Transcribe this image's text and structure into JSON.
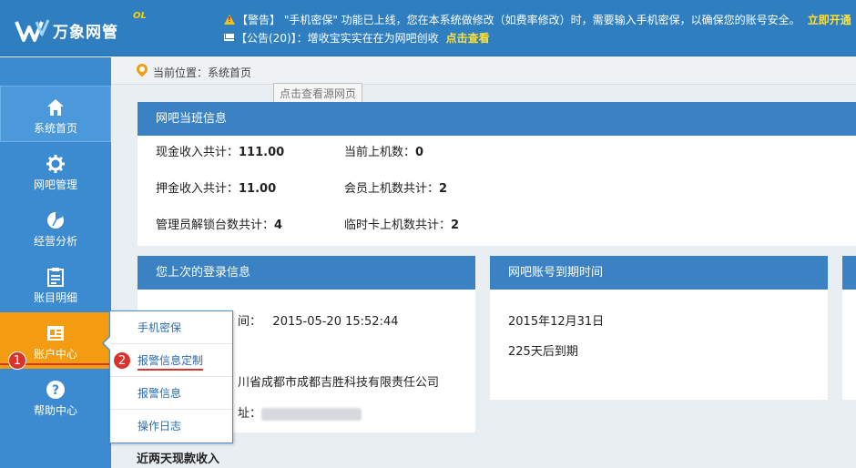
{
  "header": {
    "logo_text": "万象网管",
    "logo_sup": "OL",
    "warning_text": "【警告】 \"手机密保\" 功能已上线，您在本系统做修改（如费率修改）时，需要输入手机密保，以确保您的账号安全。",
    "warning_link": "立即开通",
    "announce_text": "【公告(20)】：增收宝实实在在为网吧创收",
    "announce_link": "点击查看"
  },
  "sidebar": {
    "items": [
      {
        "label": "系统首页",
        "icon": "home-icon"
      },
      {
        "label": "网吧管理",
        "icon": "gear-icon"
      },
      {
        "label": "经营分析",
        "icon": "pie-chart-icon"
      },
      {
        "label": "账目明细",
        "icon": "clipboard-icon"
      },
      {
        "label": "账户中心",
        "icon": "id-card-icon"
      },
      {
        "label": "帮助中心",
        "icon": "help-icon"
      }
    ]
  },
  "badges": {
    "one": "1",
    "two": "2"
  },
  "breadcrumb": {
    "text": "当前位置：系统首页"
  },
  "tooltip": {
    "text": "点击查看源网页"
  },
  "duty_panel": {
    "title": "网吧当班信息",
    "cash_label": "现金收入共计：",
    "cash_value": "111.00",
    "online_label": "当前上机数：",
    "online_value": "0",
    "deposit_label": "押金收入共计：",
    "deposit_value": "11.00",
    "member_label": "会员上机数共计：",
    "member_value": "2",
    "unlock_label": "管理员解锁台数共计：",
    "unlock_value": "4",
    "temp_label": "临时卡上机数共计：",
    "temp_value": "2"
  },
  "login_panel": {
    "title": "您上次的登录信息",
    "time_partial": "间：",
    "time_value": "2015-05-20 15:52:44",
    "company_partial": "川省成都市成都吉胜科技有限责任公司",
    "ip_partial": "址："
  },
  "expiry_panel": {
    "title": "网吧账号到期时间",
    "date": "2015年12月31日",
    "remaining": "225天后到期"
  },
  "dropdown": {
    "items": [
      "手机密保",
      "报警信息定制",
      "报警信息",
      "操作日志"
    ]
  },
  "bottom": {
    "title": "近两天现款收入"
  },
  "colors": {
    "header": "#2f7fc0",
    "sidebar": "#3c8ad0",
    "active": "#f39c12",
    "panel_head": "#3a82c4",
    "badge": "#d9342b"
  }
}
